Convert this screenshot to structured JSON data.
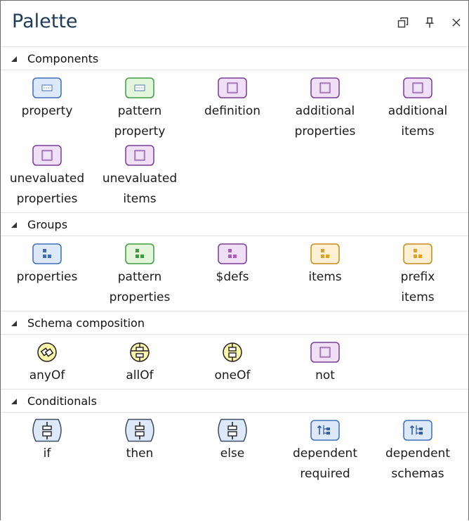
{
  "title": "Palette",
  "window_controls": [
    "restore-icon",
    "pin-icon",
    "close-icon"
  ],
  "sections": [
    {
      "title": "Components",
      "items": [
        {
          "label": "property",
          "icon": "property-icon"
        },
        {
          "label": "pattern\nproperty",
          "icon": "pattern-property-icon"
        },
        {
          "label": "definition",
          "icon": "definition-icon"
        },
        {
          "label": "additional\nproperties",
          "icon": "additional-properties-icon"
        },
        {
          "label": "additional\nitems",
          "icon": "additional-items-icon"
        },
        {
          "label": "unevaluated\nproperties",
          "icon": "unevaluated-properties-icon"
        },
        {
          "label": "unevaluated\nitems",
          "icon": "unevaluated-items-icon"
        }
      ]
    },
    {
      "title": "Groups",
      "items": [
        {
          "label": "properties",
          "icon": "properties-group-icon"
        },
        {
          "label": "pattern\nproperties",
          "icon": "pattern-properties-group-icon"
        },
        {
          "label": "$defs",
          "icon": "defs-group-icon"
        },
        {
          "label": "items",
          "icon": "items-group-icon"
        },
        {
          "label": "prefix\nitems",
          "icon": "prefix-items-group-icon"
        }
      ]
    },
    {
      "title": "Schema composition",
      "items": [
        {
          "label": "anyOf",
          "icon": "anyof-icon"
        },
        {
          "label": "allOf",
          "icon": "allof-icon"
        },
        {
          "label": "oneOf",
          "icon": "oneof-icon"
        },
        {
          "label": "not",
          "icon": "not-icon"
        }
      ]
    },
    {
      "title": "Conditionals",
      "items": [
        {
          "label": "if",
          "icon": "if-icon"
        },
        {
          "label": "then",
          "icon": "then-icon"
        },
        {
          "label": "else",
          "icon": "else-icon"
        },
        {
          "label": "dependent\nrequired",
          "icon": "dependent-required-icon"
        },
        {
          "label": "dependent\nschemas",
          "icon": "dependent-schemas-icon"
        }
      ]
    }
  ],
  "colors": {
    "title": "#1e3c5a",
    "blue_fill": "#dde8f8",
    "blue_border": "#3d6fb8",
    "green_fill": "#e3f6dc",
    "green_border": "#3f9a3f",
    "purple_fill": "#efe0f5",
    "purple_border": "#7b3a96",
    "orange_fill": "#fdf0d3",
    "orange_border": "#c98a1a",
    "yellow_fill": "#fff6a8"
  }
}
